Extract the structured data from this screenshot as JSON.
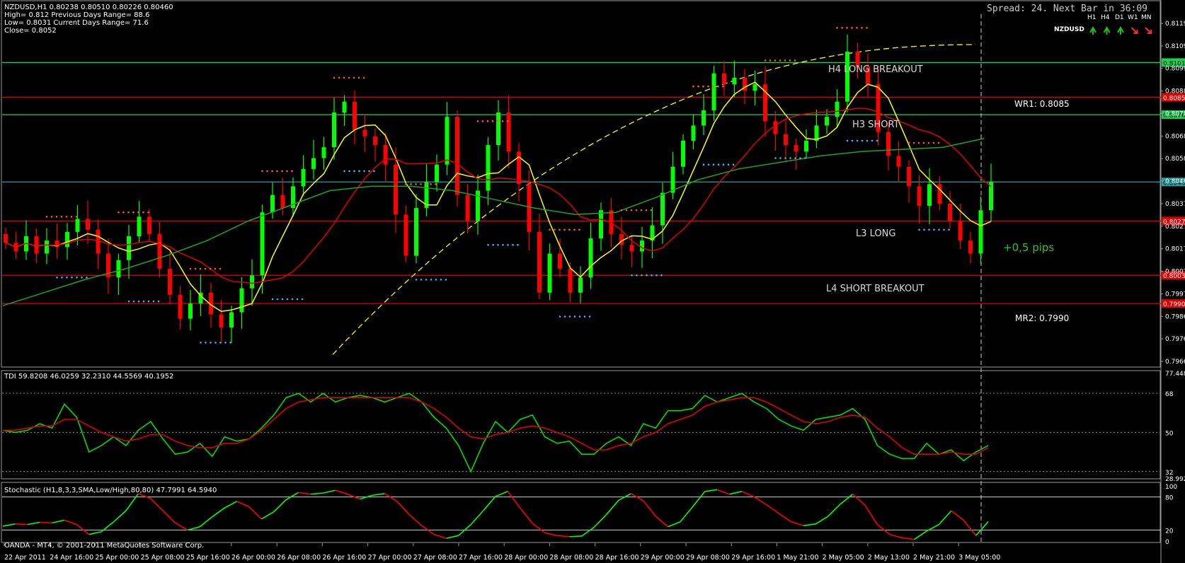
{
  "header": {
    "symbol_line": "NZDUSD,H1  0.80238 0.80510 0.80226 0.80460",
    "stats": [
      "High= 0.812    Previous Days Range= 88.6",
      "Low= 0.8031    Current Days Range= 71.6",
      "Close= 0.8052"
    ],
    "spread": "Spread: 24. Next Bar in 36:09",
    "tf_labels": [
      "H1",
      "H4",
      "D1",
      "W1",
      "MN"
    ],
    "tf_symbol": "NZDUSD",
    "tf_arrows": [
      "up",
      "up",
      "up",
      "down",
      "down"
    ],
    "tf_colors": {
      "up": "#1fbf1f",
      "down": "#ff2a2a"
    }
  },
  "footer": {
    "copyright": "OANDA - MT4, © 2001-2011 MetaQuotes Software Corp."
  },
  "colors": {
    "bull": "#00ff00",
    "bear": "#ff0000",
    "yellow": "#ffff00",
    "green_ma": "#1fa51f",
    "red_ma": "#e00000",
    "hline_green": "#19d24f",
    "hline_red": "#e00000",
    "teal_line": "#1fa5a5",
    "tdi_green": "#00dd00",
    "tdi_red": "#e00000"
  },
  "chart_data": [
    {
      "type": "candlestick",
      "title": "NZDUSD,H1",
      "ylim": [
        0.7963,
        0.8122
      ],
      "price_ticks": [
        "0.8119",
        "0.81095",
        "0.8099",
        "0.8088",
        "0.8078",
        "0.80680",
        "0.80580",
        "0.80460",
        "0.80375",
        "0.80275",
        "0.80170",
        "0.80070",
        "0.7997",
        "0.79865",
        "0.79765",
        "0.79665"
      ],
      "time_labels": [
        "22 Apr 2011",
        "24 Apr 16:00",
        "25 Apr 00:00",
        "25 Apr 08:00",
        "25 Apr 16:00",
        "26 Apr 00:00",
        "26 Apr 08:00",
        "26 Apr 16:00",
        "27 Apr 00:00",
        "27 Apr 08:00",
        "27 Apr 16:00",
        "28 Apr 00:00",
        "28 Apr 08:00",
        "28 Apr 16:00",
        "29 Apr 00:00",
        "29 Apr 08:00",
        "29 Apr 16:00",
        "1 May 21:00",
        "2 May 05:00",
        "2 May 13:00",
        "2 May 21:00",
        "3 May 05:00"
      ],
      "path": [
        0.8018,
        0.8014,
        0.8021,
        0.8013,
        0.8019,
        0.8016,
        0.8023,
        0.8029,
        0.8024,
        0.8013,
        0.8002,
        0.801,
        0.8021,
        0.803,
        0.8022,
        0.8006,
        0.7994,
        0.7983,
        0.799,
        0.7995,
        0.7985,
        0.7979,
        0.7986,
        0.7997,
        0.8003,
        0.8032,
        0.804,
        0.8034,
        0.8044,
        0.8052,
        0.8057,
        0.8062,
        0.8078,
        0.8083,
        0.807,
        0.8067,
        0.8063,
        0.8054,
        0.8031,
        0.8012,
        0.8034,
        0.8046,
        0.8054,
        0.8076,
        0.804,
        0.8028,
        0.8042,
        0.8063,
        0.8078,
        0.806,
        0.8045,
        0.8023,
        0.7995,
        0.8013,
        0.8006,
        0.7995,
        0.8002,
        0.802,
        0.8033,
        0.8022,
        0.8017,
        0.8014,
        0.8019,
        0.8026,
        0.8041,
        0.8053,
        0.8065,
        0.8072,
        0.8079,
        0.8096,
        0.8091,
        0.8094,
        0.8088,
        0.8091,
        0.8074,
        0.8068,
        0.8063,
        0.806,
        0.8065,
        0.8072,
        0.8076,
        0.8083,
        0.8106,
        0.8099,
        0.8091,
        0.8069,
        0.8058,
        0.8053,
        0.8044,
        0.8035,
        0.8045,
        0.8036,
        0.8028,
        0.8019,
        0.8013,
        0.8033,
        0.8046
      ],
      "sma": {
        "name": "",
        "values": [
          0.7989,
          0.7995,
          0.8001,
          0.8006,
          0.8012,
          0.8019,
          0.8028,
          0.8035,
          0.8042,
          0.8044,
          0.8044,
          0.8042,
          0.8038,
          0.8034,
          0.8031,
          0.8032,
          0.8039,
          0.8047,
          0.8052,
          0.8055,
          0.8058,
          0.806,
          0.8061,
          0.8062,
          0.8066
        ]
      },
      "pivot_lines": [
        {
          "label": "",
          "value": 0.8101,
          "tag": "0.81010",
          "color": "#19d24f"
        },
        {
          "label": "WR1:  0.8085",
          "value": 0.8085,
          "tag": "0.80855",
          "color": "#e00000"
        },
        {
          "label": "",
          "value": 0.8077,
          "tag": "0.80767",
          "color": "#19d24f"
        },
        {
          "label": "",
          "value": 0.8046,
          "tag": "0.80460",
          "color": "#1fa5a5"
        },
        {
          "label": "",
          "value": 0.8028,
          "tag": "0.80275",
          "color": "#e00000"
        },
        {
          "label": "",
          "value": 0.8003,
          "tag": "0.80035",
          "color": "#e00000"
        },
        {
          "label": "MR2:  0.7990",
          "value": 0.799,
          "tag": "0.79905",
          "color": "#e00000"
        }
      ],
      "annotations": [
        "H4 LONG BREAKOUT",
        "H3 SHORT",
        "L3 LONG",
        "L4 SHORT BREAKOUT",
        "+0,5 pips"
      ]
    },
    {
      "type": "line",
      "title": "TDI 59.8208 46.0259 32.2310 44.5569 40.1952",
      "ylim": [
        28.9921,
        77.4489
      ],
      "ticks": [
        "77.4489",
        "68",
        "50",
        "32",
        "28.9921"
      ],
      "levels": [
        68,
        50,
        32
      ],
      "series": [
        {
          "name": "",
          "color": "#00dd00",
          "values": [
            51,
            50,
            51,
            54,
            52,
            63,
            57,
            41,
            44,
            48,
            44,
            51,
            55,
            47,
            40,
            41,
            45,
            39,
            48,
            46,
            47,
            52,
            58,
            66,
            68,
            64,
            68,
            64,
            66,
            67,
            66,
            64,
            66,
            68,
            64,
            57,
            52,
            44,
            32,
            45,
            55,
            50,
            56,
            58,
            48,
            45,
            46,
            40,
            40,
            45,
            48,
            44,
            54,
            52,
            60,
            60,
            61,
            67,
            64,
            66,
            68,
            64,
            61,
            56,
            53,
            51,
            56,
            57,
            58,
            61,
            56,
            44,
            40,
            38,
            38,
            45,
            40,
            42,
            37,
            41,
            44
          ]
        },
        {
          "name": "",
          "color": "#e00000",
          "values": [
            51,
            51,
            52,
            53,
            53,
            56,
            56,
            53,
            50,
            48,
            46,
            47,
            49,
            49,
            46,
            44,
            43,
            43,
            45,
            45,
            47,
            51,
            56,
            61,
            64,
            65,
            66,
            66,
            66,
            66,
            66,
            66,
            66,
            66,
            64,
            61,
            57,
            52,
            48,
            47,
            49,
            50,
            52,
            53,
            52,
            50,
            48,
            45,
            42,
            42,
            44,
            45,
            48,
            50,
            54,
            56,
            58,
            62,
            64,
            65,
            66,
            66,
            64,
            61,
            58,
            55,
            54,
            55,
            57,
            58,
            57,
            52,
            48,
            43,
            40,
            40,
            40,
            41,
            40,
            40,
            43
          ]
        }
      ]
    },
    {
      "type": "line",
      "title": "Stochastic (H1,8,3,3,SMA,Low/High,80,80) 47.7991 64.5940",
      "ylim": [
        0,
        100
      ],
      "ticks": [
        "100",
        "80",
        "20",
        "0"
      ],
      "levels": [
        80,
        20
      ],
      "series": [
        {
          "name": "",
          "values": [
            27,
            31,
            30,
            34,
            33,
            38,
            30,
            12,
            17,
            35,
            55,
            86,
            77,
            55,
            33,
            20,
            26,
            44,
            60,
            72,
            62,
            40,
            53,
            75,
            88,
            85,
            87,
            92,
            85,
            76,
            83,
            86,
            72,
            48,
            28,
            12,
            5,
            10,
            30,
            55,
            81,
            90,
            60,
            32,
            15,
            10,
            8,
            9,
            25,
            48,
            74,
            86,
            73,
            45,
            26,
            35,
            62,
            90,
            93,
            85,
            90,
            80,
            66,
            50,
            35,
            28,
            31,
            45,
            67,
            85,
            65,
            30,
            12,
            6,
            3,
            18,
            30,
            55,
            38,
            10,
            35
          ]
        }
      ]
    }
  ]
}
